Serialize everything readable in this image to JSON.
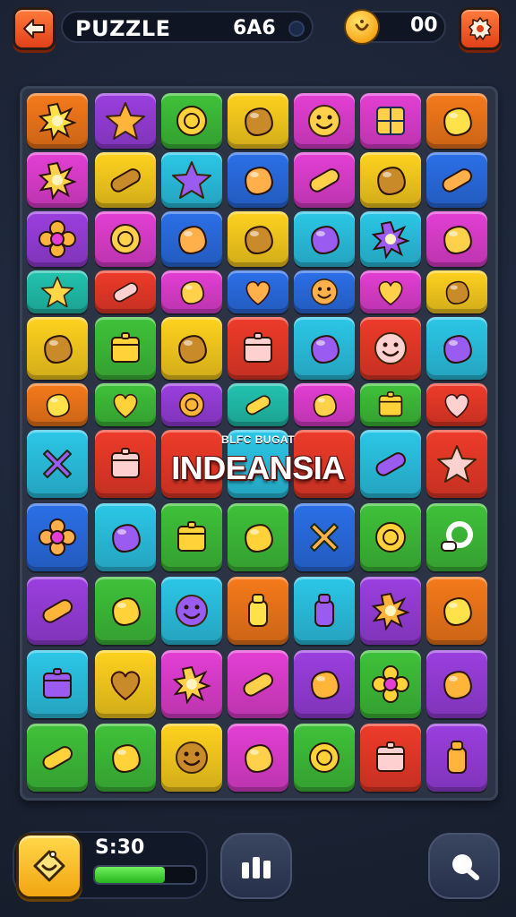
{
  "header": {
    "title": "PUZZLE",
    "score": "6A6",
    "coins": "00"
  },
  "banner": {
    "subtitle": "BLFC BUGAT",
    "title": "INDEANSIA"
  },
  "footer": {
    "timer": "S:30",
    "progress": 0.7
  },
  "colors": {
    "orange": "#f67a1b",
    "purple": "#9b3fe0",
    "green": "#3fc23a",
    "yellow": "#ffd21f",
    "magenta": "#e43fd4",
    "cyan": "#2cc7e8",
    "red": "#ef3b2a",
    "blue": "#2b6fe8",
    "teal": "#22c4b0"
  },
  "board": {
    "rows": [
      [
        {
          "color": "orange",
          "icon": "sun-burst-icon"
        },
        {
          "color": "purple",
          "icon": "star-cloud-icon"
        },
        {
          "color": "green",
          "icon": "gear-sun-icon"
        },
        {
          "color": "yellow",
          "icon": "folded-paper-icon"
        },
        {
          "color": "magenta",
          "icon": "smiley-ball-icon"
        },
        {
          "color": "magenta",
          "icon": "window-icon"
        },
        {
          "color": "orange",
          "icon": "gem-icon"
        }
      ],
      [
        {
          "color": "magenta",
          "icon": "spiky-ball-icon"
        },
        {
          "color": "yellow",
          "icon": "candy-icon"
        },
        {
          "color": "cyan",
          "icon": "star-icon"
        },
        {
          "color": "blue",
          "icon": "swirl-icon"
        },
        {
          "color": "magenta",
          "icon": "capsule-icon"
        },
        {
          "color": "yellow",
          "icon": "egg-icon"
        },
        {
          "color": "blue",
          "icon": "bone-icon"
        }
      ],
      [
        {
          "color": "purple",
          "icon": "cross-blob-icon"
        },
        {
          "color": "magenta",
          "icon": "wheel-icon"
        },
        {
          "color": "blue",
          "icon": "leaf-icon"
        },
        {
          "color": "yellow",
          "icon": "arch-icon"
        },
        {
          "color": "cyan",
          "icon": "shield-icon"
        },
        {
          "color": "cyan",
          "icon": "urchin-icon"
        },
        {
          "color": "magenta",
          "icon": "puzzle-piece-icon"
        }
      ],
      [
        {
          "color": "teal",
          "icon": "face-star-icon"
        },
        {
          "color": "red",
          "icon": "roll-icon"
        },
        {
          "color": "magenta",
          "icon": "blob-icon"
        },
        {
          "color": "blue",
          "icon": "heart-wing-icon"
        },
        {
          "color": "blue",
          "icon": "face-oval-icon"
        },
        {
          "color": "magenta",
          "icon": "heart-icon"
        },
        {
          "color": "yellow",
          "icon": "pear-icon"
        }
      ],
      [
        {
          "color": "yellow",
          "icon": "spiral-shell-icon"
        },
        {
          "color": "green",
          "icon": "box-icon"
        },
        {
          "color": "yellow",
          "icon": "magnifier-blob-icon"
        },
        {
          "color": "red",
          "icon": "cube-icon"
        },
        {
          "color": "cyan",
          "icon": "tool-icon"
        },
        {
          "color": "red",
          "icon": "smiley-icon"
        },
        {
          "color": "cyan",
          "icon": "crystal-icon"
        }
      ],
      [
        {
          "color": "orange",
          "icon": "cookie-icon"
        },
        {
          "color": "green",
          "icon": "heart-icon"
        },
        {
          "color": "purple",
          "icon": "ring-icon"
        },
        {
          "color": "teal",
          "icon": "eraser-icon"
        },
        {
          "color": "magenta",
          "icon": "bean-icon"
        },
        {
          "color": "green",
          "icon": "block-icon"
        },
        {
          "color": "red",
          "icon": "heart-icon"
        }
      ],
      [
        {
          "color": "cyan",
          "icon": "x-mark-icon"
        },
        {
          "color": "red",
          "icon": "crate-icon"
        },
        {
          "color": "red",
          "icon": "blank-icon"
        },
        {
          "color": "cyan",
          "icon": "blank-icon"
        },
        {
          "color": "red",
          "icon": "blank-icon"
        },
        {
          "color": "cyan",
          "icon": "crystal-wand-icon"
        },
        {
          "color": "red",
          "icon": "star-icon"
        }
      ],
      [
        {
          "color": "blue",
          "icon": "flower-icon"
        },
        {
          "color": "cyan",
          "icon": "feather-icon"
        },
        {
          "color": "green",
          "icon": "safe-icon"
        },
        {
          "color": "green",
          "icon": "taco-icon"
        },
        {
          "color": "blue",
          "icon": "x-mark-icon"
        },
        {
          "color": "green",
          "icon": "coin-gear-icon"
        },
        {
          "color": "green",
          "icon": "key-ring-icon"
        }
      ],
      [
        {
          "color": "purple",
          "icon": "carrot-icon"
        },
        {
          "color": "green",
          "icon": "acorn-icon"
        },
        {
          "color": "cyan",
          "icon": "cat-face-icon"
        },
        {
          "color": "orange",
          "icon": "bottle-icon"
        },
        {
          "color": "cyan",
          "icon": "jar-icon"
        },
        {
          "color": "purple",
          "icon": "virus-icon"
        },
        {
          "color": "orange",
          "icon": "leaf-icon"
        }
      ],
      [
        {
          "color": "cyan",
          "icon": "cash-icon"
        },
        {
          "color": "yellow",
          "icon": "apple-icon"
        },
        {
          "color": "magenta",
          "icon": "sun-face-icon"
        },
        {
          "color": "magenta",
          "icon": "pickle-icon"
        },
        {
          "color": "purple",
          "icon": "comb-icon"
        },
        {
          "color": "green",
          "icon": "flower-icon"
        },
        {
          "color": "purple",
          "icon": "camel-icon"
        }
      ],
      [
        {
          "color": "green",
          "icon": "capsule-icon"
        },
        {
          "color": "green",
          "icon": "plum-icon"
        },
        {
          "color": "yellow",
          "icon": "smiley-icon"
        },
        {
          "color": "magenta",
          "icon": "onion-icon"
        },
        {
          "color": "green",
          "icon": "globe-icon"
        },
        {
          "color": "red",
          "icon": "ticket-icon"
        },
        {
          "color": "purple",
          "icon": "cylinder-icon"
        }
      ]
    ]
  }
}
